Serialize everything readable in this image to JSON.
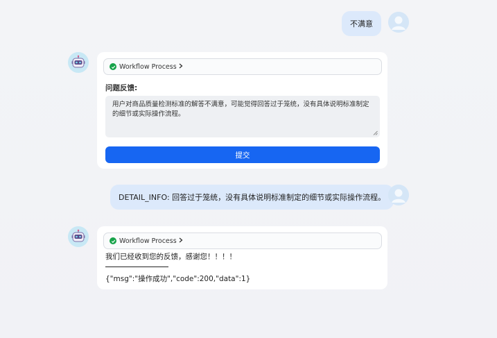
{
  "messages": [
    {
      "role": "user",
      "text": "不满意"
    },
    {
      "role": "assistant",
      "workflow_label": "Workflow Process",
      "feedback_label": "问题反馈:",
      "feedback_value": "用户对商品质量检测标准的解答不满意，可能觉得回答过于笼统，没有具体说明标准制定的细节或实际操作流程。",
      "submit_label": "提交"
    },
    {
      "role": "user",
      "text": "DETAIL_INFO: 回答过于笼统，没有具体说明标准制定的细节或实际操作流程。"
    },
    {
      "role": "assistant",
      "workflow_label": "Workflow Process",
      "reply_text": "我们已经收到您的反馈，感谢您！！！！",
      "result_text": "{\"msg\":\"操作成功\",\"code\":200,\"data\":1}"
    }
  ],
  "colors": {
    "accent": "#1766f2",
    "success": "#17a34a",
    "user_bubble": "#dce9fb"
  },
  "icons": {
    "user_avatar": "user-avatar-icon",
    "bot_avatar": "robot-icon",
    "workflow_status": "check-circle-icon",
    "workflow_expand": "chevron-right-icon"
  }
}
